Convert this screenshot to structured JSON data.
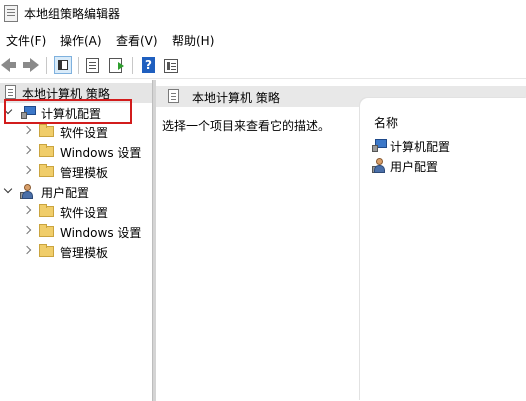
{
  "window": {
    "title": "本地组策略编辑器"
  },
  "menu": [
    "文件(F)",
    "操作(A)",
    "查看(V)",
    "帮助(H)"
  ],
  "toolbar": {
    "help_glyph": "?"
  },
  "tree": {
    "root": "本地计算机 策略",
    "computer_config": {
      "label": "计算机配置",
      "children": [
        "软件设置",
        "Windows 设置",
        "管理模板"
      ]
    },
    "user_config": {
      "label": "用户配置",
      "children": [
        "软件设置",
        "Windows 设置",
        "管理模板"
      ]
    }
  },
  "right_pane": {
    "header": "本地计算机 策略",
    "description": "选择一个项目来查看它的描述。",
    "column_name": "名称",
    "items": [
      "计算机配置",
      "用户配置"
    ]
  },
  "colors": {
    "highlight": "#d21c1c",
    "folder": "#f0cd6a",
    "selection_bg": "#e5e5e5"
  }
}
